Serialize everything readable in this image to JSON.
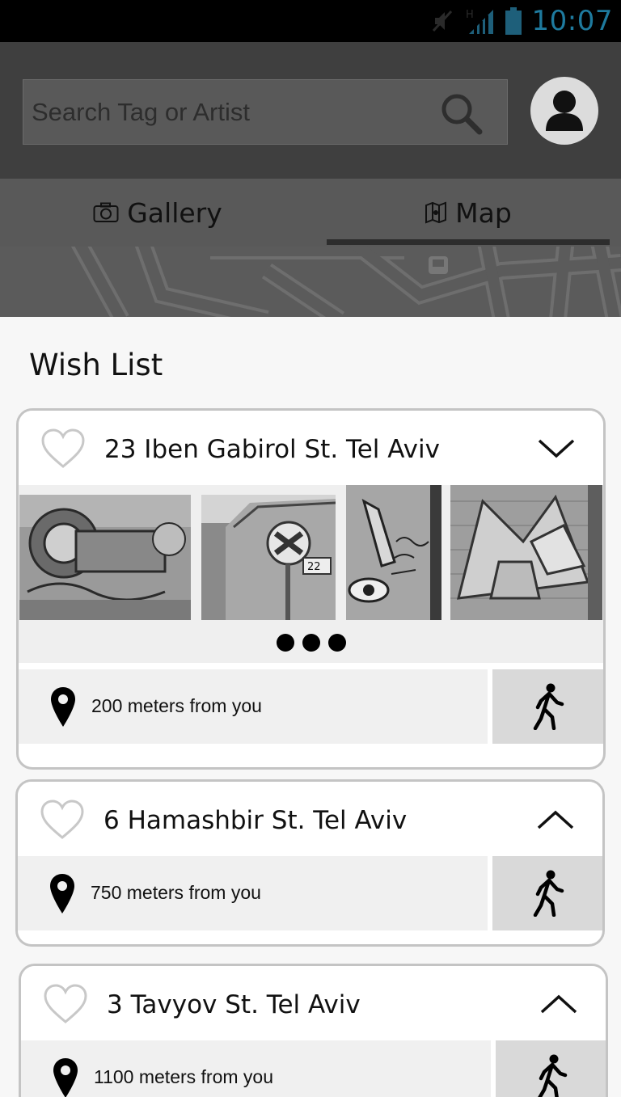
{
  "status_bar": {
    "time": "10:07",
    "network": "H"
  },
  "search": {
    "placeholder": "Search Tag or Artist"
  },
  "tabs": [
    {
      "label": "Gallery"
    },
    {
      "label": "Map"
    }
  ],
  "wish_list": {
    "title": "Wish List",
    "items": [
      {
        "address": "23 Iben Gabirol St. Tel Aviv",
        "distance": "200 meters from you",
        "expanded": true
      },
      {
        "address": "6 Hamashbir St. Tel Aviv",
        "distance": "750 meters from you",
        "expanded": false
      },
      {
        "address": "3 Tavyov St. Tel Aviv",
        "distance": "1100 meters from you",
        "expanded": false
      }
    ]
  },
  "colors": {
    "status_bar": "#000000",
    "header": "#3f3f3f",
    "tabs": "#595959",
    "clock": "#1e7a9e",
    "walk_button": "#d9d9d9"
  }
}
